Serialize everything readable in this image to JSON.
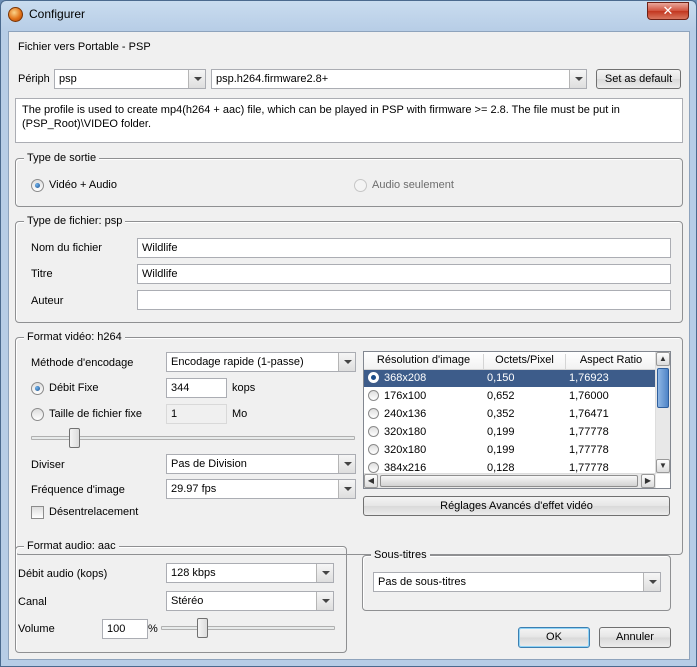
{
  "window": {
    "title": "Configurer",
    "close_glyph": "✕"
  },
  "profile_header": "Fichier vers Portable - PSP",
  "device": {
    "label": "Périph",
    "device_value": "psp",
    "profile_value": "psp.h264.firmware2.8+",
    "set_default_label": "Set as default"
  },
  "description": "The profile is used to create mp4(h264 + aac) file, which can be played in PSP with firmware >= 2.8. The file must be put in (PSP_Root)\\VIDEO folder.",
  "output_type": {
    "legend": "Type de sortie",
    "video_audio_label": "Vidéo + Audio",
    "audio_only_label": "Audio seulement"
  },
  "file_type": {
    "legend": "Type de fichier: psp",
    "filename_label": "Nom du fichier",
    "filename_value": "Wildlife",
    "title_label": "Titre",
    "title_value": "Wildlife",
    "author_label": "Auteur",
    "author_value": ""
  },
  "video_format": {
    "legend": "Format vidéo: h264",
    "encoding_label": "Méthode d'encodage",
    "encoding_value": "Encodage rapide (1-passe)",
    "fixed_bitrate_label": "Débit Fixe",
    "fixed_bitrate_value": "344",
    "fixed_bitrate_unit": "kops",
    "filesize_label": "Taille de fichier fixe",
    "filesize_value": "1",
    "filesize_unit": "Mo",
    "quality_slider": 0.12,
    "divide_label": "Diviser",
    "divide_value": "Pas de Division",
    "framerate_label": "Fréquence d'image",
    "framerate_value": "29.97 fps",
    "deinterlace_label": "Désentrelacement",
    "advanced_button": "Réglages Avancés d'effet vidéo",
    "resolution_table": {
      "headers": [
        "Résolution d'image",
        "Octets/Pixel",
        "Aspect Ratio"
      ],
      "rows": [
        {
          "res": "368x208",
          "bpp": "0,150",
          "ratio": "1,76923",
          "selected": true
        },
        {
          "res": "176x100",
          "bpp": "0,652",
          "ratio": "1,76000",
          "selected": false
        },
        {
          "res": "240x136",
          "bpp": "0,352",
          "ratio": "1,76471",
          "selected": false
        },
        {
          "res": "320x180",
          "bpp": "0,199",
          "ratio": "1,77778",
          "selected": false
        },
        {
          "res": "320x180",
          "bpp": "0,199",
          "ratio": "1,77778",
          "selected": false
        },
        {
          "res": "384x216",
          "bpp": "0,128",
          "ratio": "1,77778",
          "selected": false
        }
      ]
    }
  },
  "audio_format": {
    "legend": "Format audio: aac",
    "bitrate_label": "Débit audio (kops)",
    "bitrate_value": "128 kbps",
    "channel_label": "Canal",
    "channel_value": "Stéréo",
    "volume_label": "Volume",
    "volume_value": "100",
    "volume_unit": "%",
    "volume_slider": 0.22
  },
  "subtitles": {
    "legend": "Sous-titres",
    "value": "Pas de sous-titres"
  },
  "buttons": {
    "ok": "OK",
    "cancel": "Annuler"
  },
  "colors": {
    "selection": "#3d5c8a",
    "title_bar": "#b7cde6",
    "close": "#c2361f"
  }
}
